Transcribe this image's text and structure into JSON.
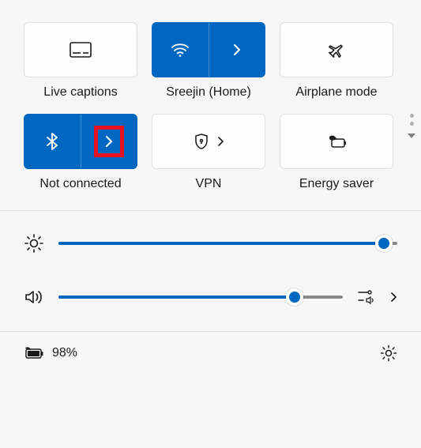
{
  "tiles": {
    "live_captions": {
      "label": "Live captions",
      "active": false
    },
    "wifi": {
      "label": "Sreejin (Home)",
      "active": true
    },
    "airplane": {
      "label": "Airplane mode",
      "active": false
    },
    "bluetooth": {
      "label": "Not connected",
      "active": true,
      "highlighted": true
    },
    "vpn": {
      "label": "VPN",
      "active": false
    },
    "energy": {
      "label": "Energy saver",
      "active": false
    }
  },
  "sliders": {
    "brightness": {
      "value": 96
    },
    "volume": {
      "value": 83
    }
  },
  "battery": {
    "text": "98%"
  },
  "colors": {
    "accent": "#0067c0",
    "highlight": "#e81123"
  }
}
